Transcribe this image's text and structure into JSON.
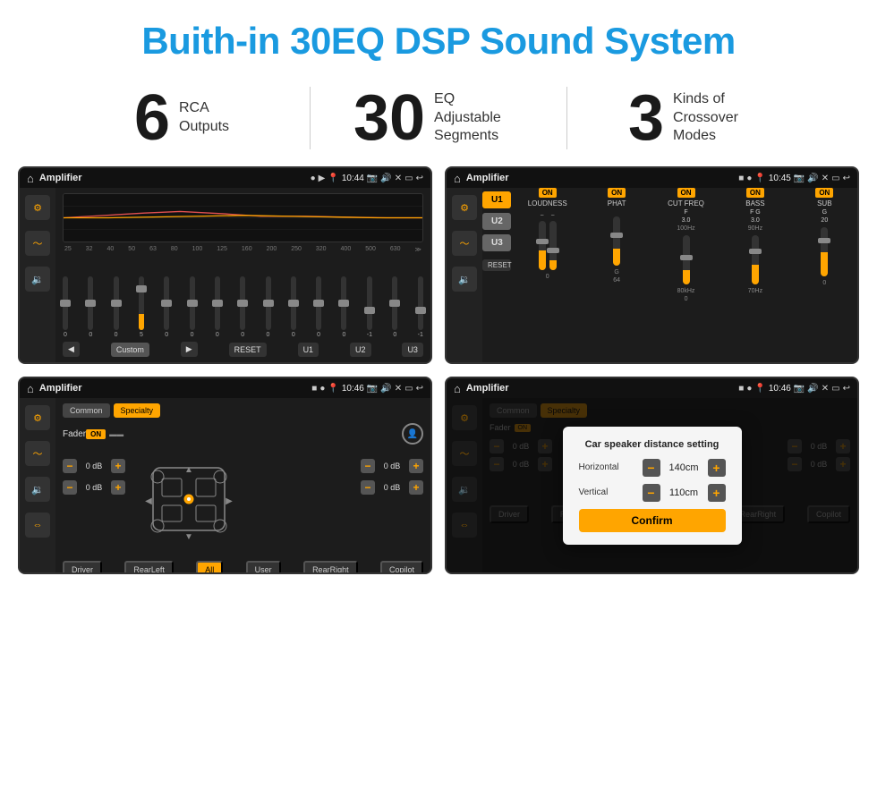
{
  "header": {
    "title": "Buith-in 30EQ DSP Sound System"
  },
  "stats": [
    {
      "number": "6",
      "text": "RCA\nOutputs"
    },
    {
      "number": "30",
      "text": "EQ Adjustable\nSegments"
    },
    {
      "number": "3",
      "text": "Kinds of\nCrossover Modes"
    }
  ],
  "screens": [
    {
      "id": "eq-screen",
      "statusBar": {
        "appName": "Amplifier",
        "time": "10:44"
      }
    },
    {
      "id": "crossover-screen",
      "statusBar": {
        "appName": "Amplifier",
        "time": "10:45"
      }
    },
    {
      "id": "fader-screen",
      "statusBar": {
        "appName": "Amplifier",
        "time": "10:46"
      }
    },
    {
      "id": "dialog-screen",
      "statusBar": {
        "appName": "Amplifier",
        "time": "10:46"
      },
      "dialog": {
        "title": "Car speaker distance setting",
        "horizontal_label": "Horizontal",
        "horizontal_value": "140cm",
        "vertical_label": "Vertical",
        "vertical_value": "110cm",
        "confirm_label": "Confirm"
      }
    }
  ],
  "eq": {
    "frequencies": [
      "25",
      "32",
      "40",
      "50",
      "63",
      "80",
      "100",
      "125",
      "160",
      "200",
      "250",
      "320",
      "400",
      "500",
      "630"
    ],
    "values": [
      "0",
      "0",
      "0",
      "5",
      "0",
      "0",
      "0",
      "0",
      "0",
      "0",
      "0",
      "0",
      "-1",
      "0",
      "-1"
    ],
    "buttons": [
      "Custom",
      "RESET",
      "U1",
      "U2",
      "U3"
    ]
  },
  "crossover": {
    "units": [
      "U1",
      "U2",
      "U3"
    ],
    "channels": [
      "LOUDNESS",
      "PHAT",
      "CUT FREQ",
      "BASS",
      "SUB"
    ],
    "reset_label": "RESET"
  },
  "fader": {
    "tabs": [
      "Common",
      "Specialty"
    ],
    "fader_label": "Fader",
    "on_label": "ON",
    "db_left1": "0 dB",
    "db_left2": "0 dB",
    "db_right1": "0 dB",
    "db_right2": "0 dB",
    "buttons": [
      "Driver",
      "RearLeft",
      "All",
      "User",
      "RearRight",
      "Copilot"
    ]
  }
}
